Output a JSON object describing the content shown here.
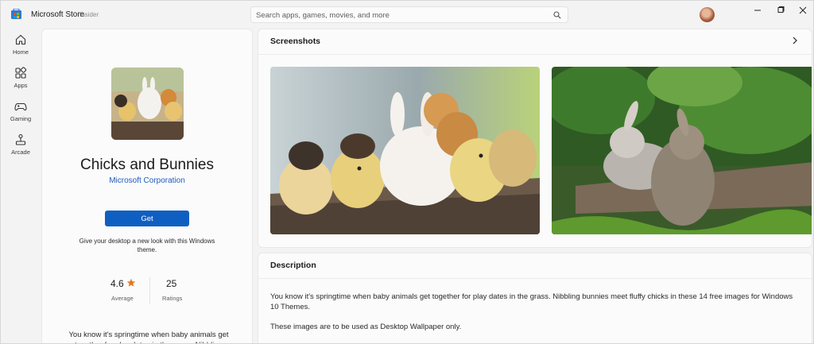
{
  "titlebar": {
    "app_title": "Microsoft Store",
    "badge": "Insider",
    "search_placeholder": "Search apps, games, movies, and more"
  },
  "rail": {
    "items": [
      {
        "label": "Home",
        "icon": "home-icon"
      },
      {
        "label": "Apps",
        "icon": "apps-icon"
      },
      {
        "label": "Gaming",
        "icon": "gamepad-icon"
      },
      {
        "label": "Arcade",
        "icon": "arcade-icon"
      }
    ]
  },
  "product": {
    "name": "Chicks and Bunnies",
    "publisher": "Microsoft Corporation",
    "get_label": "Get",
    "tagline": "Give your desktop a new look with this Windows theme.",
    "rating": "4.6",
    "rating_label": "Average",
    "ratings_count": "25",
    "ratings_label": "Ratings",
    "description_preview": "You know it's springtime when baby animals get together for play dates in the grass. Nibbling"
  },
  "screenshots": {
    "title": "Screenshots"
  },
  "description": {
    "title": "Description",
    "paragraphs": [
      "You know it's springtime when baby animals get together for play dates in the grass. Nibbling bunnies meet fluffy chicks in these 14 free images for Windows 10 Themes.",
      "These images are to be used as Desktop Wallpaper only."
    ]
  },
  "colors": {
    "accent": "#0f5fc2",
    "link": "#1e5bbf",
    "star": "#e07a1f"
  }
}
